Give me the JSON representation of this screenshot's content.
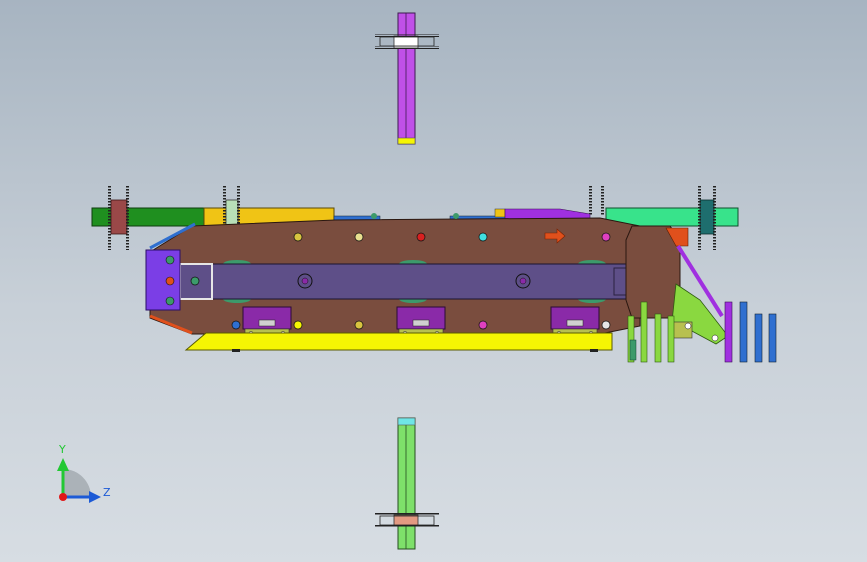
{
  "viewport": {
    "background_top": "#a7b4c1",
    "background_bottom": "#d7dde3"
  },
  "triad": {
    "y_label": "Y",
    "z_label": "Z",
    "y_color": "#22c833",
    "z_color": "#1c5ad6",
    "x_color": "#e01818"
  },
  "model": {
    "body_color": "#7a4d3e",
    "slider_color": "#5e4f88",
    "base_plate_color": "#f5f503",
    "left_end_block_color": "#7b3ee6",
    "shaft_left_color": "#1f8f1f",
    "shaft_middle_color": "#f0c415",
    "shaft_right_color": "#38e38b",
    "top_shaft_color": "#c050e8",
    "bottom_shaft_color": "#7ee06a",
    "clamp_color": "#8a2aa8",
    "arrow_color": "#e0501c"
  }
}
